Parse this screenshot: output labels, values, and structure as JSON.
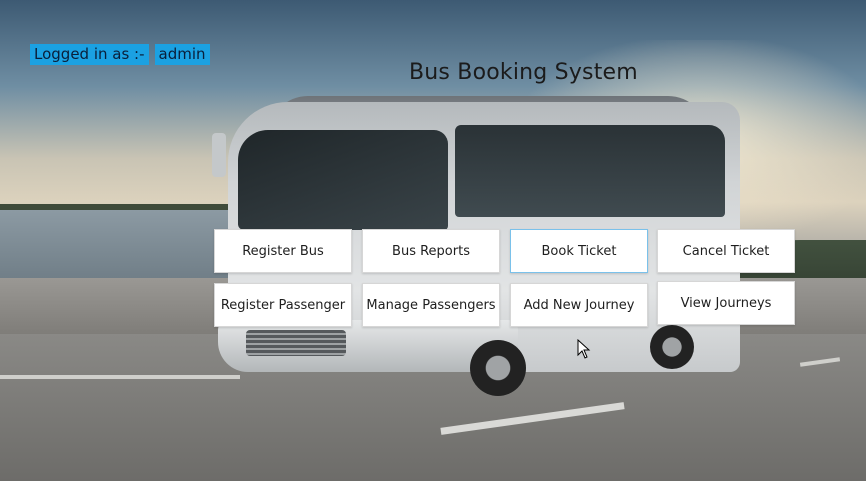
{
  "header": {
    "login_label": "Logged in as :-",
    "username": "admin",
    "title": "Bus Booking System"
  },
  "buttons": {
    "register_bus": "Register Bus",
    "bus_reports": "Bus Reports",
    "book_ticket": "Book Ticket",
    "cancel_ticket": "Cancel Ticket",
    "register_passenger": "Register Passenger",
    "manage_passengers": "Manage Passengers",
    "add_new_journey": "Add New Journey",
    "view_journeys": "View Journeys"
  },
  "colors": {
    "login_badge": "#1ba1e2",
    "button_bg": "#ffffff"
  },
  "icons": [
    "mouse-cursor-icon"
  ]
}
